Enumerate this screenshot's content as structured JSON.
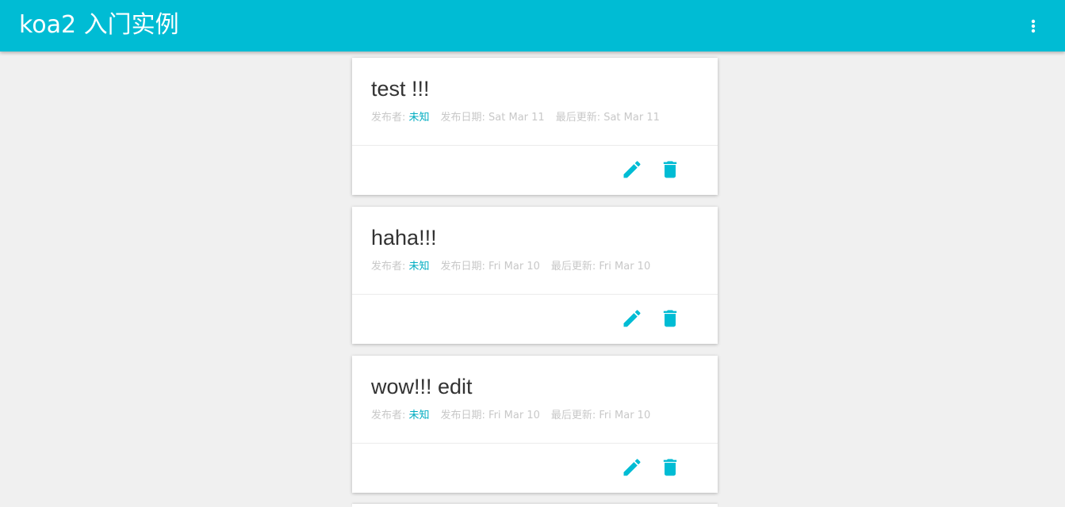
{
  "appbar": {
    "title": "koa2 入门实例",
    "menu_icon": "more-vert-icon",
    "color": "#00bcd4"
  },
  "labels": {
    "author": "发布者: ",
    "published": "发布日期: ",
    "updated": "最后更新: "
  },
  "accent_color": "#00bcd4",
  "posts": [
    {
      "title": "test !!!",
      "author": "未知",
      "published": "Sat Mar 11",
      "updated": "Sat Mar 11"
    },
    {
      "title": "haha!!!",
      "author": "未知",
      "published": "Fri Mar 10",
      "updated": "Fri Mar 10"
    },
    {
      "title": "wow!!! edit",
      "author": "未知",
      "published": "Fri Mar 10",
      "updated": "Fri Mar 10"
    }
  ],
  "actions": {
    "edit_icon": "pencil-icon",
    "delete_icon": "trash-icon"
  }
}
